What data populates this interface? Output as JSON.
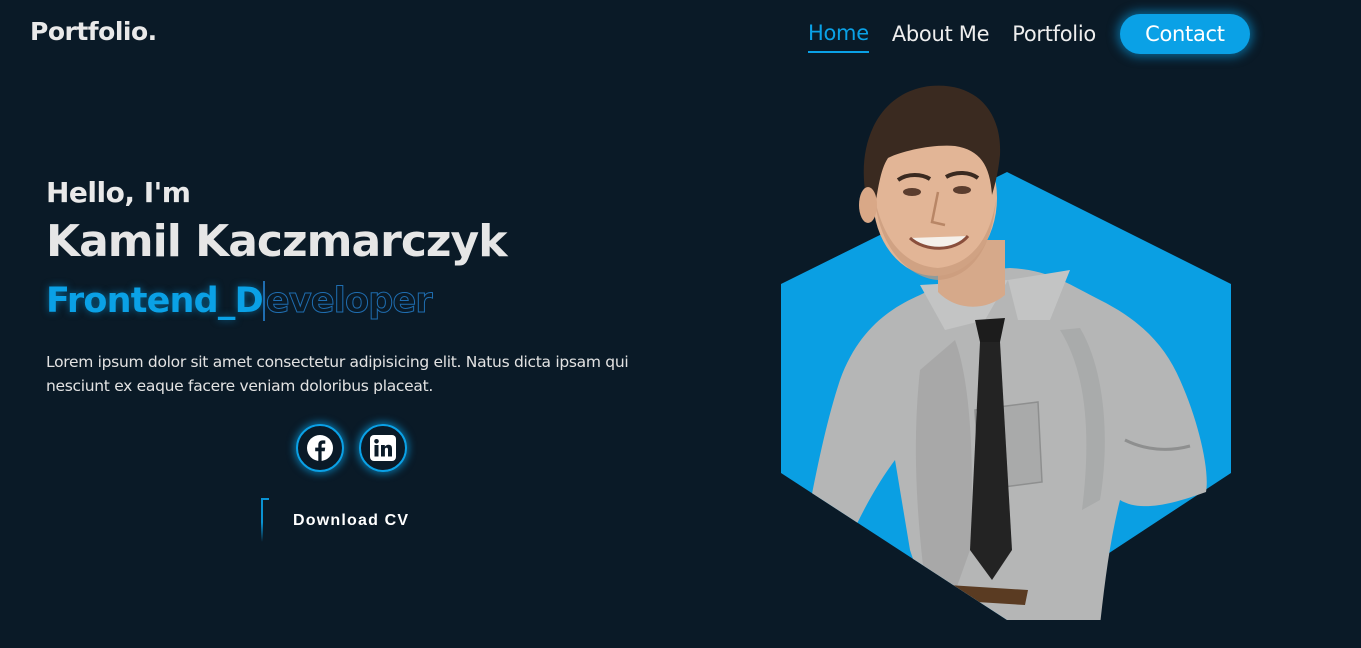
{
  "header": {
    "logo": "Portfolio.",
    "nav": [
      {
        "label": "Home",
        "active": true
      },
      {
        "label": "About Me",
        "active": false
      },
      {
        "label": "Portfolio",
        "active": false
      }
    ],
    "contact_label": "Contact"
  },
  "hero": {
    "greeting": "Hello, I'm",
    "name": "Kamil Kaczmarczyk",
    "role_typed": "Frontend_D",
    "role_rest": "eveloper",
    "intro": "Lorem ipsum dolor sit amet consectetur adipisicing elit. Natus dicta ipsam qui nesciunt ex eaque facere veniam doloribus placeat.",
    "socials": [
      {
        "icon": "facebook-icon"
      },
      {
        "icon": "linkedin-icon"
      }
    ],
    "download_label": "Download CV"
  },
  "colors": {
    "background": "#0a1a27",
    "accent": "#0aa1e6",
    "text": "#ececec"
  }
}
